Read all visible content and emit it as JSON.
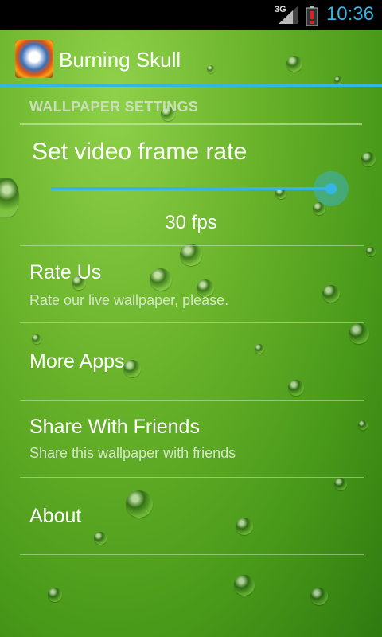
{
  "status_bar": {
    "time": "10:36",
    "network": "3G",
    "battery_icon": "battery-alert-icon",
    "accent": "#33b5e5"
  },
  "action_bar": {
    "title": "Burning Skull",
    "icon": "skull-app-icon"
  },
  "settings": {
    "section_header": "WALLPAPER SETTINGS",
    "frame_rate": {
      "title": "Set video frame rate",
      "value_label": "30 fps",
      "slider_level": 1.0
    },
    "items": [
      {
        "title": "Rate Us",
        "summary": "Rate our live wallpaper, please."
      },
      {
        "title": "More Apps",
        "summary": ""
      },
      {
        "title": "Share With Friends",
        "summary": "Share this wallpaper with friends"
      },
      {
        "title": "About",
        "summary": ""
      }
    ]
  }
}
